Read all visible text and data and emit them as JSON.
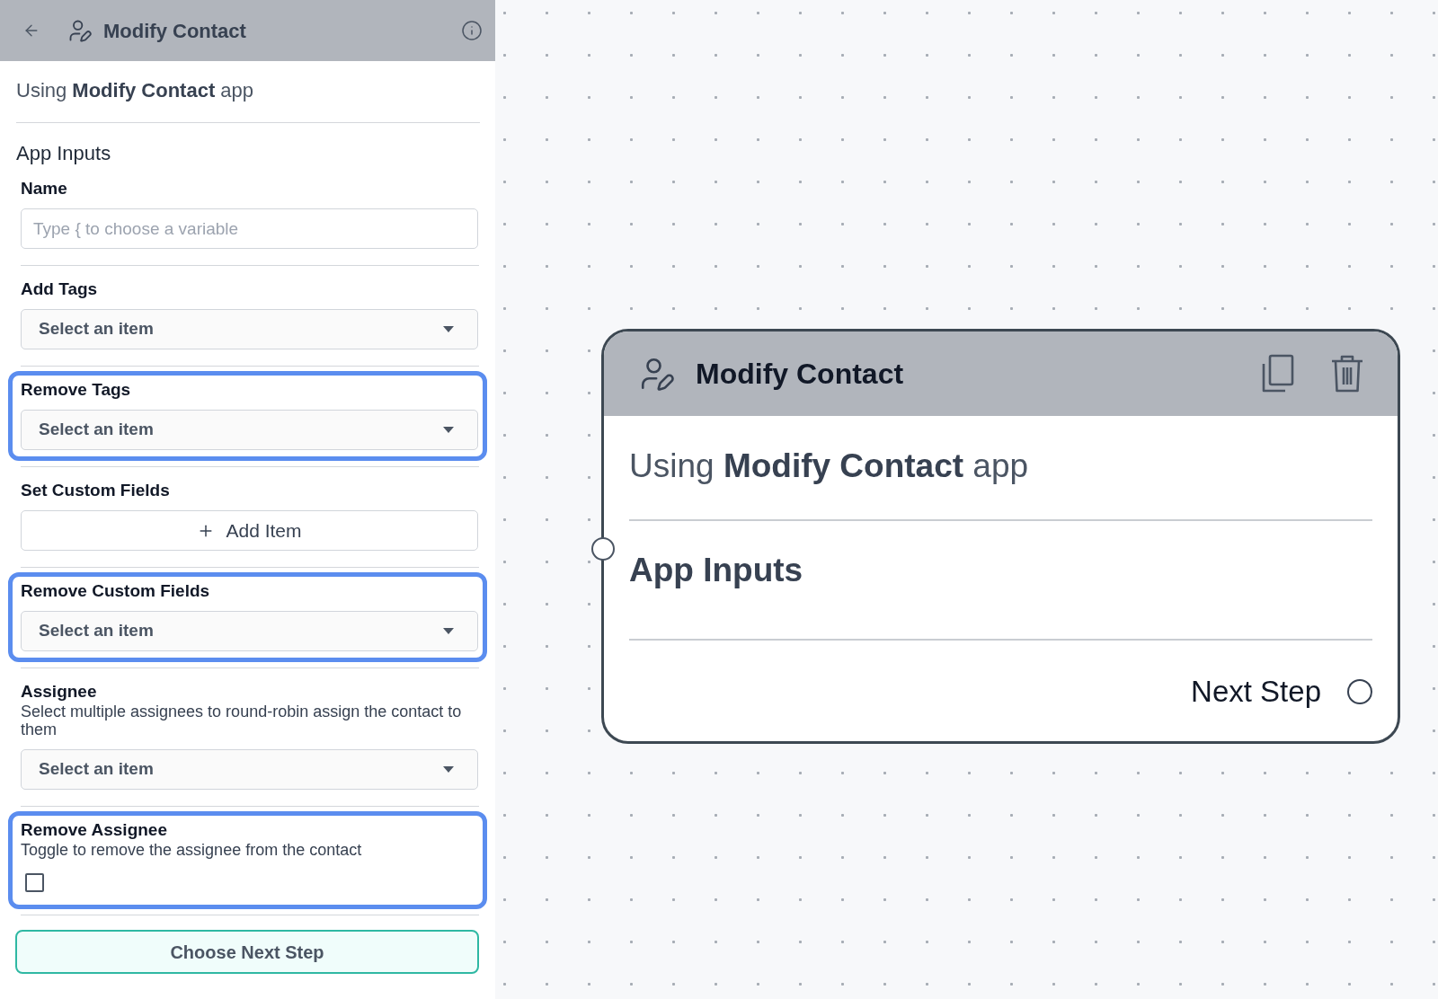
{
  "sidebar": {
    "header": {
      "title": "Modify Contact"
    },
    "app_line": "Using **Modify Contact** app",
    "section_title": "App Inputs",
    "fields": [
      {
        "kind": "text",
        "label": "Name",
        "placeholder": "Type { to choose a variable",
        "highlighted": false
      },
      {
        "kind": "select",
        "label": "Add Tags",
        "placeholder": "Select an item",
        "highlighted": false
      },
      {
        "kind": "select",
        "label": "Remove Tags",
        "placeholder": "Select an item",
        "highlighted": true
      },
      {
        "kind": "add",
        "label": "Set Custom Fields",
        "button": "Add Item",
        "highlighted": false
      },
      {
        "kind": "select",
        "label": "Remove Custom Fields",
        "placeholder": "Select an item",
        "highlighted": true
      },
      {
        "kind": "select",
        "label": "Assignee",
        "description": "Select multiple assignees to round-robin assign the contact to them",
        "placeholder": "Select an item",
        "highlighted": false
      },
      {
        "kind": "checkbox",
        "label": "Remove Assignee",
        "description": "Toggle to remove the assignee from the contact",
        "checked": false,
        "highlighted": true
      }
    ],
    "next_button": "Choose Next Step"
  },
  "node": {
    "title": "Modify Contact",
    "app_line": "Using **Modify Contact** app",
    "section_title": "App Inputs",
    "output_label": "Next Step"
  }
}
